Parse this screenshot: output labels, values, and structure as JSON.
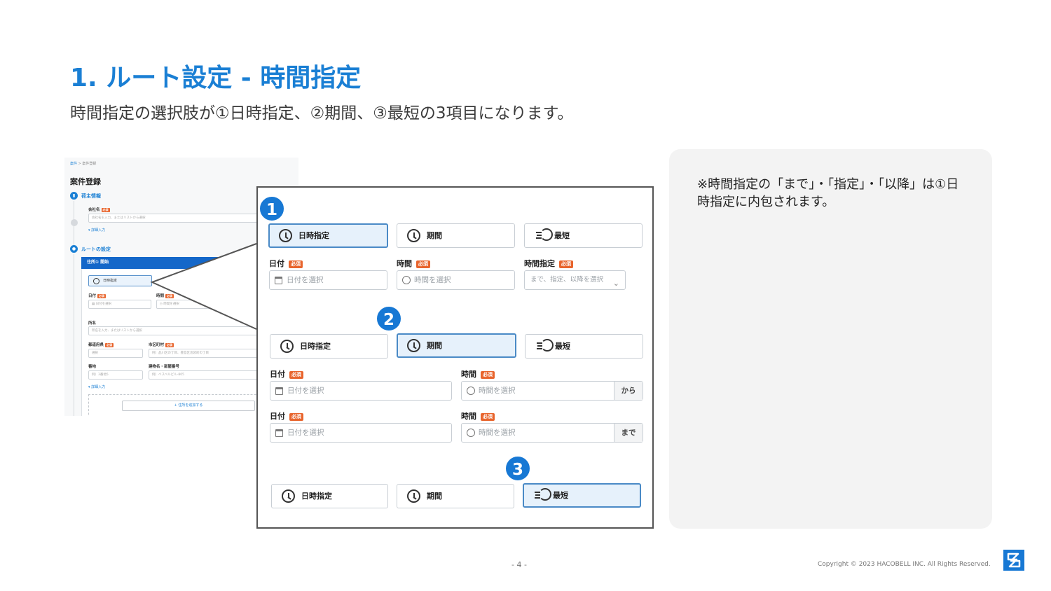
{
  "slide": {
    "title": "1. ルート設定 - 時間指定",
    "subtitle": "時間指定の選択肢が①日時指定、②期間、③最短の3項目になります。",
    "page_number": "- 4 -",
    "copyright": "Copyright © 2023 HACOBELL INC. All Rights Reserved."
  },
  "note": {
    "text": "※時間指定の「まで」・「指定」・「以降」は①日時指定に内包されます。"
  },
  "bg_screenshot": {
    "breadcrumb_link": "案件",
    "breadcrumb_sep": ">",
    "breadcrumb_current": "案件登録",
    "page_title": "案件登録",
    "step1_label": "荷主情報",
    "company_label": "会社名",
    "required": "必須",
    "company_placeholder": "会社名を入力、またはリストから選択",
    "detail_link": "詳細入力",
    "step2_label": "ルートの設定",
    "address_bar": "住所① 開始",
    "chip_label": "日時指定",
    "date_label": "日付",
    "date_placeholder": "日付を選択",
    "time_label": "時間",
    "time_placeholder": "時間を選択",
    "place_label": "所名",
    "place_placeholder": "所名を入力、またはリストから選択",
    "pref_label": "都道府県",
    "pref_placeholder": "選択",
    "city_label": "市区町村",
    "city_placeholder": "例）品川区の丁目、豊島区池袋町の丁目",
    "street_label": "番地",
    "street_placeholder": "例）3番地5",
    "building_label": "建物名・部屋番号",
    "building_placeholder": "例）ベスベルビル-805",
    "detail_link2": "詳細入力",
    "add_address": "+ 住所を追加する"
  },
  "zoom": {
    "badges": [
      "1",
      "2",
      "3"
    ],
    "options": {
      "datetime": "日時指定",
      "period": "期間",
      "fastest": "最短"
    },
    "required": "必須",
    "section1": {
      "date_label": "日付",
      "date_placeholder": "日付を選択",
      "time_label": "時間",
      "time_placeholder": "時間を選択",
      "timespec_label": "時間指定",
      "timespec_placeholder": "まで、指定、以降を選択"
    },
    "section2": {
      "row1_date_label": "日付",
      "row1_date_placeholder": "日付を選択",
      "row1_time_label": "時間",
      "row1_time_placeholder": "時間を選択",
      "row1_suffix": "から",
      "row2_date_label": "日付",
      "row2_date_placeholder": "日付を選択",
      "row2_time_label": "時間",
      "row2_time_placeholder": "時間を選択",
      "row2_suffix": "まで"
    }
  },
  "colors": {
    "accent": "#1a7fd4",
    "badge": "#1778d4",
    "required": "#e8642c",
    "selected_bg": "#e6f1fb"
  }
}
